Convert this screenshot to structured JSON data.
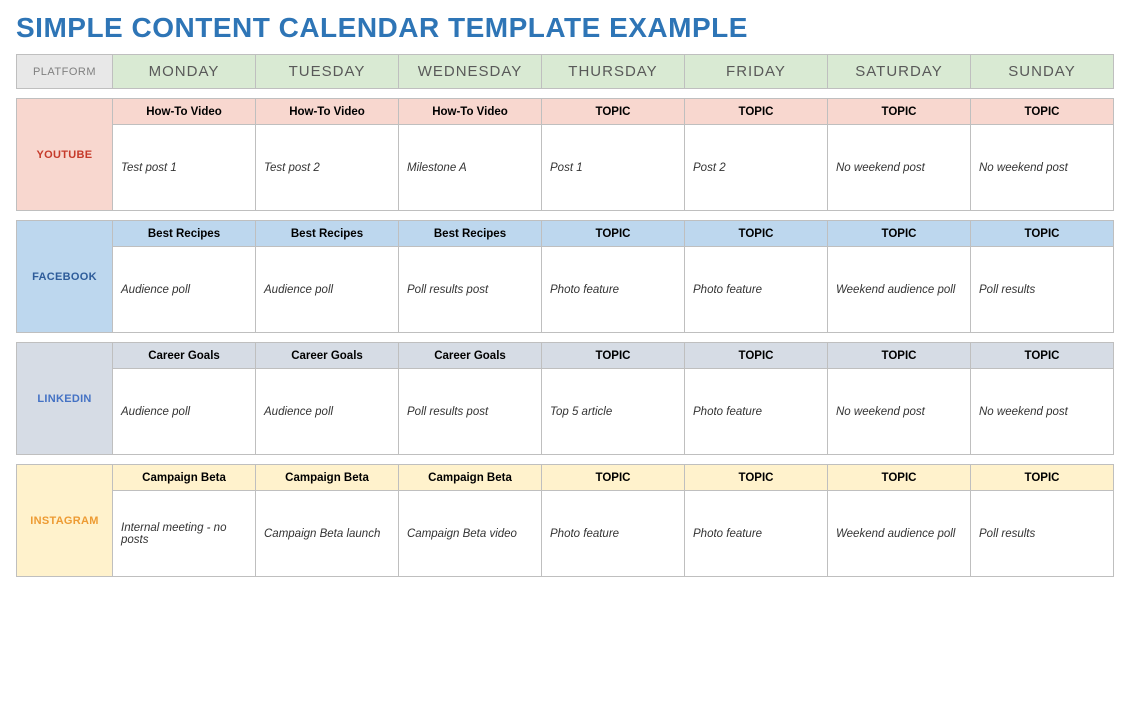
{
  "title": "SIMPLE CONTENT CALENDAR TEMPLATE EXAMPLE",
  "corner_label": "PLATFORM",
  "days": [
    "MONDAY",
    "TUESDAY",
    "WEDNESDAY",
    "THURSDAY",
    "FRIDAY",
    "SATURDAY",
    "SUNDAY"
  ],
  "platforms": [
    {
      "key": "youtube",
      "label": "YOUTUBE",
      "topics": [
        "How-To Video",
        "How-To Video",
        "How-To Video",
        "TOPIC",
        "TOPIC",
        "TOPIC",
        "TOPIC"
      ],
      "content": [
        "Test post 1",
        "Test post 2",
        "Milestone A",
        "Post 1",
        "Post 2",
        "No weekend post",
        "No weekend post"
      ]
    },
    {
      "key": "facebook",
      "label": "FACEBOOK",
      "topics": [
        "Best Recipes",
        "Best Recipes",
        "Best Recipes",
        "TOPIC",
        "TOPIC",
        "TOPIC",
        "TOPIC"
      ],
      "content": [
        "Audience poll",
        "Audience poll",
        "Poll results post",
        "Photo feature",
        "Photo feature",
        "Weekend audience poll",
        "Poll results"
      ]
    },
    {
      "key": "linkedin",
      "label": "LINKEDIN",
      "topics": [
        "Career Goals",
        "Career Goals",
        "Career Goals",
        "TOPIC",
        "TOPIC",
        "TOPIC",
        "TOPIC"
      ],
      "content": [
        "Audience poll",
        "Audience poll",
        "Poll results post",
        "Top 5 article",
        "Photo feature",
        "No weekend post",
        "No weekend post"
      ]
    },
    {
      "key": "instagram",
      "label": "INSTAGRAM",
      "topics": [
        "Campaign Beta",
        "Campaign Beta",
        "Campaign Beta",
        "TOPIC",
        "TOPIC",
        "TOPIC",
        "TOPIC"
      ],
      "content": [
        "Internal meeting - no posts",
        "Campaign Beta launch",
        "Campaign Beta video",
        "Photo feature",
        "Photo feature",
        "Weekend audience poll",
        "Poll results"
      ]
    }
  ]
}
